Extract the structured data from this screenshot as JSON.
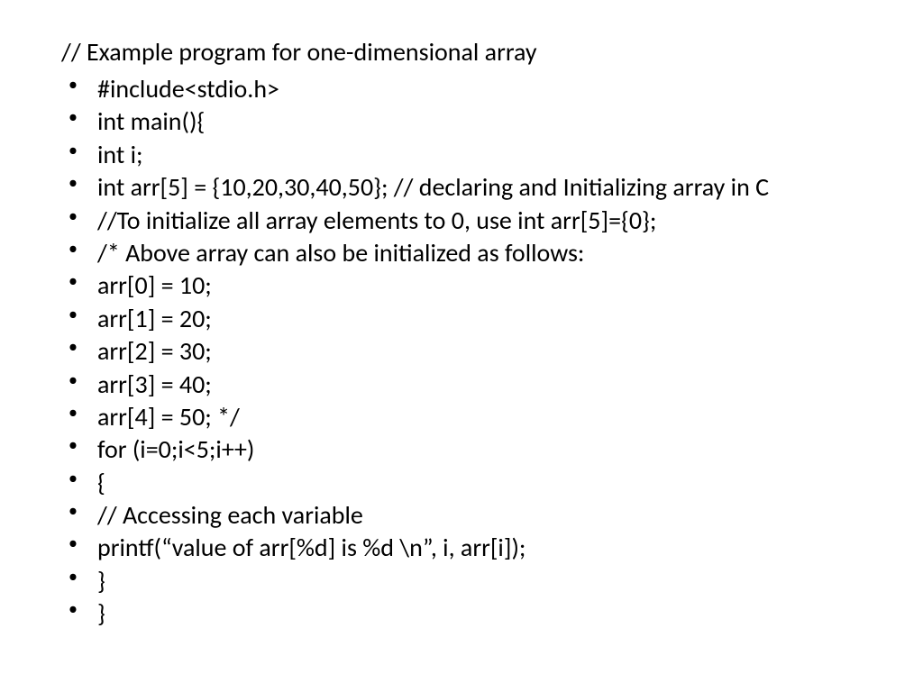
{
  "title": "// Example program for one-dimensional array",
  "lines": [
    "#include<stdio.h>",
    "int main(){",
    "int i;",
    "int arr[5] = {10,20,30,40,50}; // declaring and Initializing array in C",
    "//To initialize all array elements to 0, use int arr[5]={0};",
    "/* Above array can also be initialized as follows:",
    "arr[0] = 10;",
    "arr[1] = 20;",
    "arr[2] = 30;",
    "arr[3] = 40;",
    "arr[4] = 50; */",
    "for (i=0;i<5;i++)",
    "{",
    "// Accessing each variable",
    "printf(“value of arr[%d] is %d \\n”, i, arr[i]);",
    "}",
    "}"
  ]
}
